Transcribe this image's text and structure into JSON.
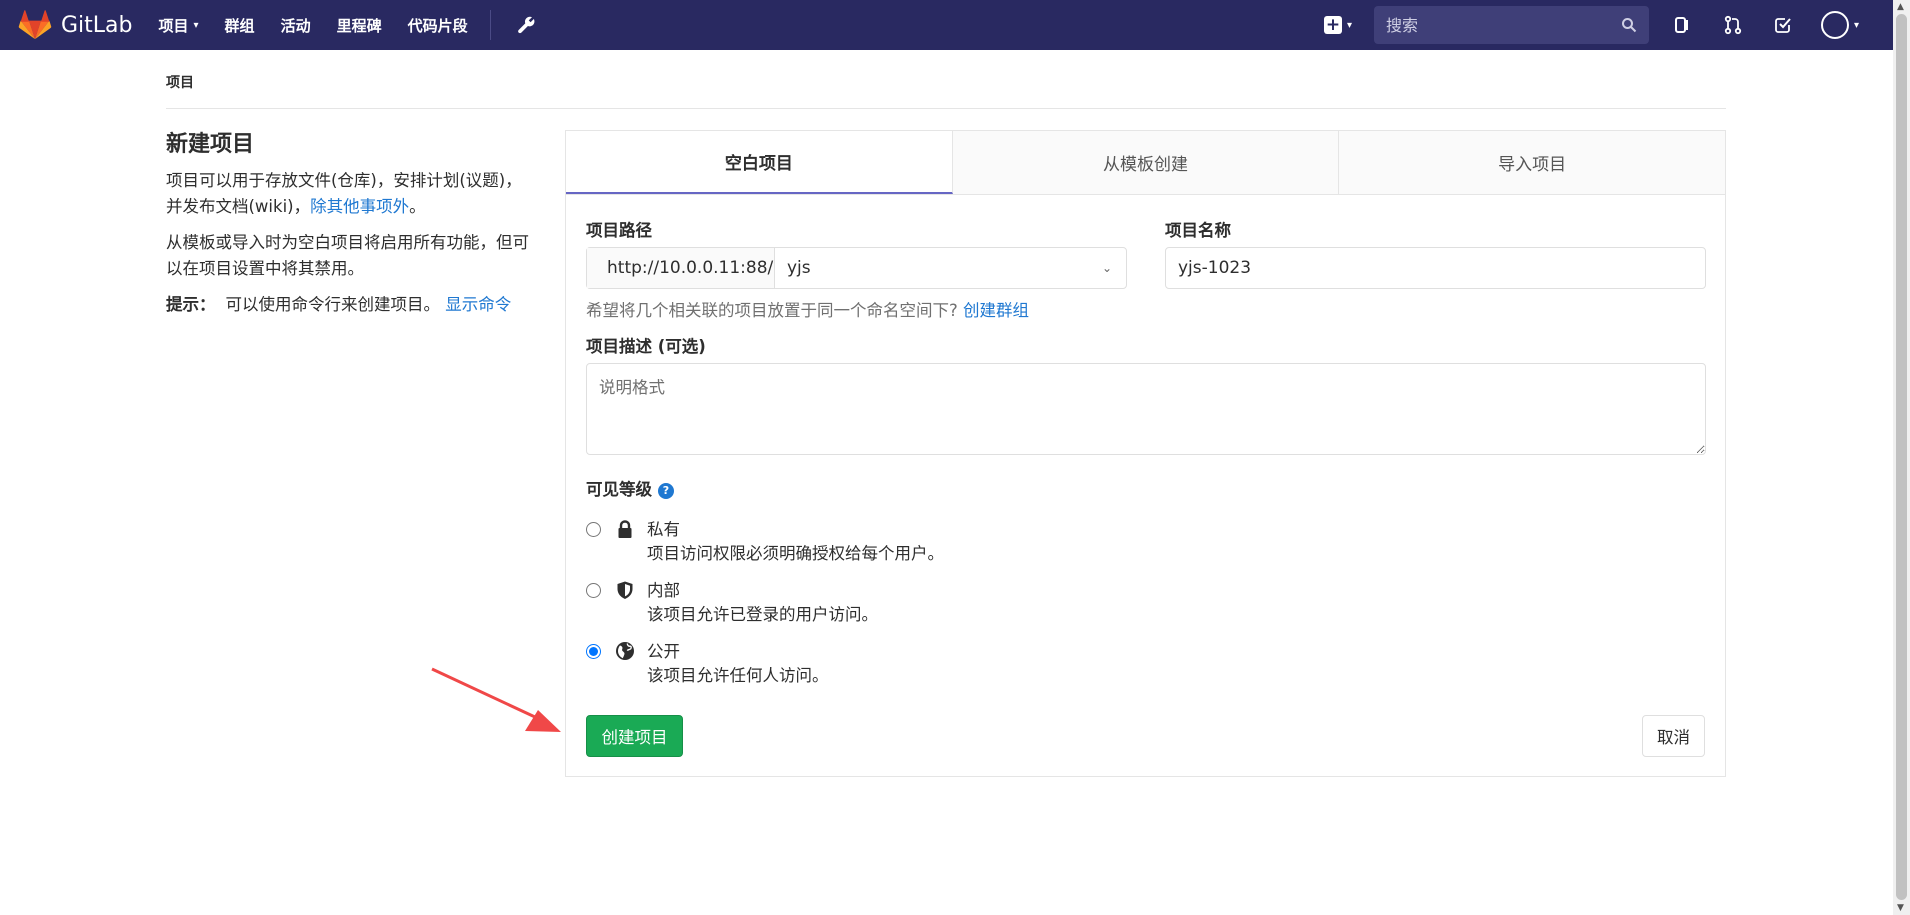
{
  "nav": {
    "logo_text": "GitLab",
    "projects": "项目",
    "groups": "群组",
    "activity": "活动",
    "milestones": "里程碑",
    "snippets": "代码片段",
    "search_placeholder": "搜索"
  },
  "breadcrumb": "项目",
  "left": {
    "title": "新建项目",
    "desc1": "项目可以用于存放文件(仓库)，安排计划(议题)，并发布文档(wiki)，",
    "desc1_link": "除其他事项外",
    "desc1_end": "。",
    "desc2": "从模板或导入时为空白项目将启用所有功能，但可以在项目设置中将其禁用。",
    "tip_label": "提示：",
    "tip_text": "可以使用命令行来创建项目。",
    "tip_link": "显示命令"
  },
  "tabs": [
    {
      "label": "空白项目",
      "active": true
    },
    {
      "label": "从模板创建",
      "active": false
    },
    {
      "label": "导入项目",
      "active": false
    }
  ],
  "form": {
    "path_label": "项目路径",
    "path_prefix": "http://10.0.0.11:88/",
    "namespace": "yjs",
    "name_label": "项目名称",
    "name_value": "yjs-1023",
    "help_text": "希望将几个相关联的项目放置于同一个命名空间下?",
    "help_link": "创建群组",
    "desc_label": "项目描述 (可选)",
    "desc_placeholder": "说明格式",
    "visibility_label": "可见等级",
    "visibility_options": [
      {
        "title": "私有",
        "desc": "项目访问权限必须明确授权给每个用户。",
        "icon": "lock-icon",
        "checked": false
      },
      {
        "title": "内部",
        "desc": "该项目允许已登录的用户访问。",
        "icon": "shield-icon",
        "checked": false
      },
      {
        "title": "公开",
        "desc": "该项目允许任何人访问。",
        "icon": "globe-icon",
        "checked": true
      }
    ],
    "create_button": "创建项目",
    "cancel_button": "取消"
  },
  "colors": {
    "nav_bg": "#292961",
    "primary_green": "#1aaa55",
    "link_blue": "#1f78d1",
    "annotation_arrow": "#f04848"
  }
}
